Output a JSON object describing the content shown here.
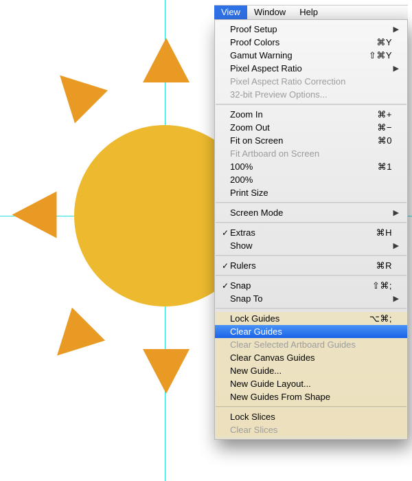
{
  "menubar": {
    "view": "View",
    "window": "Window",
    "help": "Help"
  },
  "menu": {
    "proof_setup": "Proof Setup",
    "proof_colors": "Proof Colors",
    "proof_colors_sc": "⌘Y",
    "gamut_warning": "Gamut Warning",
    "gamut_warning_sc": "⇧⌘Y",
    "pixel_aspect_ratio": "Pixel Aspect Ratio",
    "pixel_aspect_correction": "Pixel Aspect Ratio Correction",
    "preview_32bit": "32-bit Preview Options...",
    "zoom_in": "Zoom In",
    "zoom_in_sc": "⌘+",
    "zoom_out": "Zoom Out",
    "zoom_out_sc": "⌘−",
    "fit_on_screen": "Fit on Screen",
    "fit_on_screen_sc": "⌘0",
    "fit_artboard": "Fit Artboard on Screen",
    "hundred": "100%",
    "hundred_sc": "⌘1",
    "two_hundred": "200%",
    "print_size": "Print Size",
    "screen_mode": "Screen Mode",
    "extras": "Extras",
    "extras_sc": "⌘H",
    "show": "Show",
    "rulers": "Rulers",
    "rulers_sc": "⌘R",
    "snap": "Snap",
    "snap_sc": "⇧⌘;",
    "snap_to": "Snap To",
    "lock_guides": "Lock Guides",
    "lock_guides_sc": "⌥⌘;",
    "clear_guides": "Clear Guides",
    "clear_selected_artboard": "Clear Selected Artboard Guides",
    "clear_canvas_guides": "Clear Canvas Guides",
    "new_guide": "New Guide...",
    "new_guide_layout": "New Guide Layout...",
    "new_guides_from_shape": "New Guides From Shape",
    "lock_slices": "Lock Slices",
    "clear_slices": "Clear Slices"
  }
}
